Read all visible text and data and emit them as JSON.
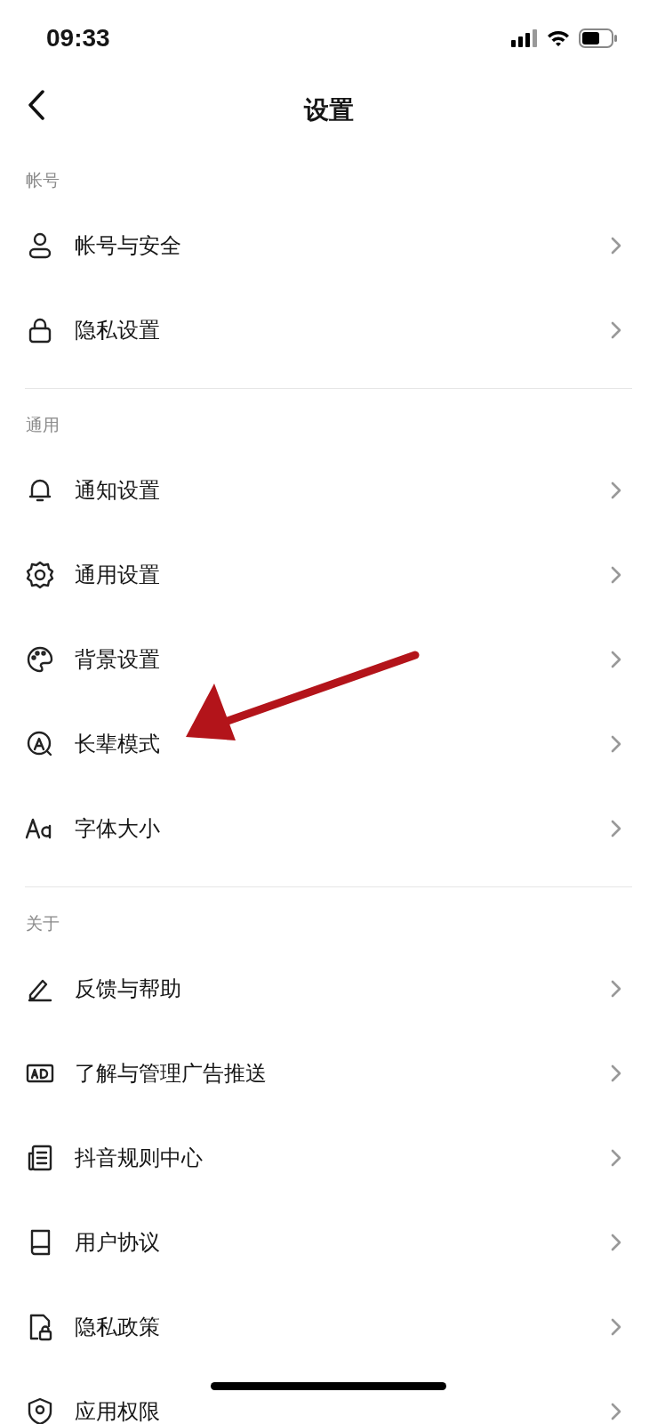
{
  "status_bar": {
    "time": "09:33"
  },
  "header": {
    "title": "设置"
  },
  "sections": [
    {
      "title": "帐号",
      "items": [
        {
          "label": "帐号与安全"
        },
        {
          "label": "隐私设置"
        }
      ]
    },
    {
      "title": "通用",
      "items": [
        {
          "label": "通知设置"
        },
        {
          "label": "通用设置"
        },
        {
          "label": "背景设置"
        },
        {
          "label": "长辈模式"
        },
        {
          "label": "字体大小"
        }
      ]
    },
    {
      "title": "关于",
      "items": [
        {
          "label": "反馈与帮助"
        },
        {
          "label": "了解与管理广告推送"
        },
        {
          "label": "抖音规则中心"
        },
        {
          "label": "用户协议"
        },
        {
          "label": "隐私政策"
        },
        {
          "label": "应用权限"
        }
      ]
    }
  ]
}
